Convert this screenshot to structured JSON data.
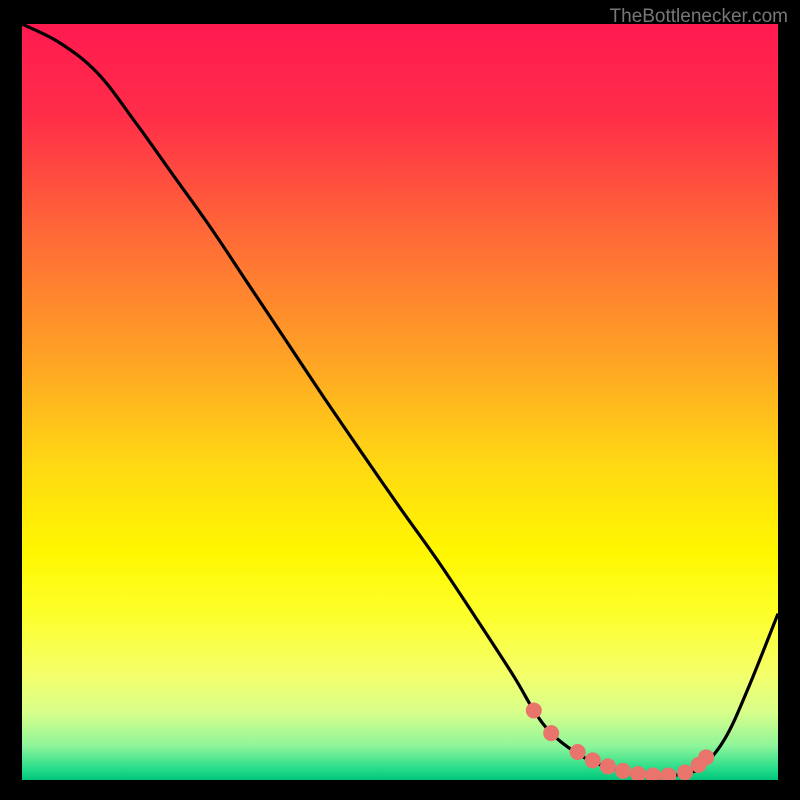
{
  "watermark": "TheBottlenecker.com",
  "chart_data": {
    "type": "line",
    "title": "",
    "xlabel": "",
    "ylabel": "",
    "series": [
      {
        "name": "curve",
        "x": [
          0.0,
          0.05,
          0.1,
          0.15,
          0.2,
          0.25,
          0.3,
          0.35,
          0.4,
          0.45,
          0.5,
          0.55,
          0.6,
          0.65,
          0.677,
          0.7,
          0.73,
          0.76,
          0.79,
          0.82,
          0.85,
          0.875,
          0.9,
          0.93,
          0.96,
          1.0
        ],
        "y": [
          1.0,
          0.975,
          0.935,
          0.87,
          0.8,
          0.73,
          0.655,
          0.58,
          0.505,
          0.432,
          0.36,
          0.29,
          0.215,
          0.138,
          0.092,
          0.062,
          0.038,
          0.022,
          0.013,
          0.008,
          0.006,
          0.008,
          0.018,
          0.055,
          0.12,
          0.22
        ]
      }
    ],
    "marker_points": [
      {
        "x": 0.677,
        "y": 0.092
      },
      {
        "x": 0.7,
        "y": 0.062
      },
      {
        "x": 0.735,
        "y": 0.037
      },
      {
        "x": 0.755,
        "y": 0.026
      },
      {
        "x": 0.775,
        "y": 0.018
      },
      {
        "x": 0.795,
        "y": 0.012
      },
      {
        "x": 0.815,
        "y": 0.008
      },
      {
        "x": 0.835,
        "y": 0.006
      },
      {
        "x": 0.855,
        "y": 0.006
      },
      {
        "x": 0.877,
        "y": 0.01
      },
      {
        "x": 0.895,
        "y": 0.02
      },
      {
        "x": 0.905,
        "y": 0.03
      }
    ],
    "xlim": [
      0,
      1
    ],
    "ylim": [
      0,
      1
    ],
    "gradient_stops": [
      {
        "pos": 0.0,
        "color": "#ff1a50"
      },
      {
        "pos": 0.12,
        "color": "#ff2d49"
      },
      {
        "pos": 0.28,
        "color": "#ff6a37"
      },
      {
        "pos": 0.44,
        "color": "#ffa225"
      },
      {
        "pos": 0.58,
        "color": "#ffd814"
      },
      {
        "pos": 0.7,
        "color": "#fff700"
      },
      {
        "pos": 0.78,
        "color": "#fdff2a"
      },
      {
        "pos": 0.86,
        "color": "#f4ff6a"
      },
      {
        "pos": 0.91,
        "color": "#d9ff8a"
      },
      {
        "pos": 0.955,
        "color": "#8ef59a"
      },
      {
        "pos": 0.985,
        "color": "#27dd8a"
      },
      {
        "pos": 1.0,
        "color": "#00c47a"
      }
    ]
  }
}
